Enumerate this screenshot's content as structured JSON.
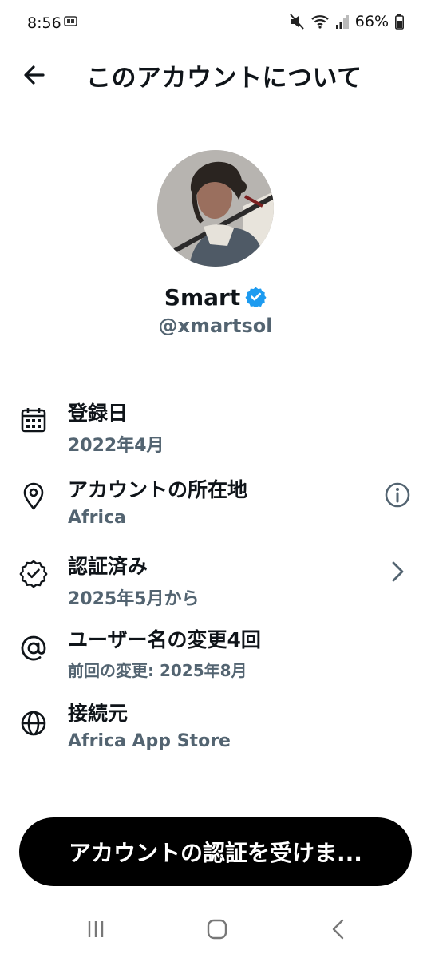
{
  "status_bar": {
    "time": "8:56",
    "battery": "66%"
  },
  "header": {
    "title": "このアカウントについて"
  },
  "profile": {
    "display_name": "Smart",
    "handle": "@xmartsol",
    "verified_color": "#1d9bf0"
  },
  "info_rows": [
    {
      "icon": "calendar-icon",
      "label": "登録日",
      "value": "2022年4月"
    },
    {
      "icon": "location-pin-icon",
      "label": "アカウントの所在地",
      "value": "Africa",
      "trailing": "info-icon"
    },
    {
      "icon": "verified-badge-icon",
      "label": "認証済み",
      "value": "2025年5月から",
      "trailing": "chevron-right-icon"
    },
    {
      "icon": "at-sign-icon",
      "label": "ユーザー名の変更4回",
      "value": "前回の変更: 2025年8月"
    },
    {
      "icon": "globe-icon",
      "label": "接続元",
      "value": "Africa App Store"
    }
  ],
  "cta": {
    "label": "アカウントの認証を受けま..."
  },
  "colors": {
    "text_primary": "#0f1419",
    "text_secondary": "#536471",
    "button_bg": "#000000"
  }
}
